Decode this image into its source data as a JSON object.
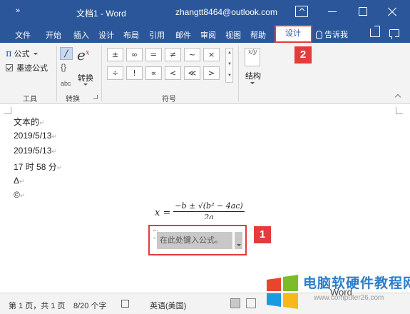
{
  "title_bar": {
    "quick_access": "»",
    "doc_title": "文档1 - Word",
    "account": "zhangtt8464@outlook.com"
  },
  "tabs": {
    "items": [
      "文件",
      "开始",
      "插入",
      "设计",
      "布局",
      "引用",
      "邮件",
      "审阅",
      "视图",
      "帮助"
    ],
    "active_contextual": "设计",
    "tell_me": "告诉我"
  },
  "ribbon": {
    "tools": {
      "equation": "公式",
      "ink_equation": "墨迹公式",
      "group_label": "工具"
    },
    "conversions": {
      "label": "转换",
      "group_label": "转换",
      "abc": "abc",
      "linear_glyph": "/",
      "braces_glyph": "{}",
      "big_glyph": "e",
      "big_sup": "x"
    },
    "symbols": {
      "row1": [
        "±",
        "∞",
        "=",
        "≠",
        "~",
        "×"
      ],
      "row2": [
        "÷",
        "!",
        "∝",
        "<",
        "≪",
        ">"
      ],
      "group_label": "符号"
    },
    "structures": {
      "label": "结构",
      "icon_text": "x/y"
    }
  },
  "document": {
    "lines": [
      "文本的",
      "2019/5/13",
      "2019/5/13",
      "17 时 58 分",
      "Δ",
      "©"
    ],
    "paragraph_mark": "↵",
    "formula": {
      "lhs": "x =",
      "numerator": "−b ± √(b² − 4ac)",
      "denominator": "2a"
    },
    "equation_placeholder": "在此处键入公式。"
  },
  "callouts": {
    "step1": "1",
    "step2": "2",
    "color": "#e53b3b"
  },
  "status_bar": {
    "page": "第 1 页，共 1 页",
    "words": "8/20 个字",
    "language": "英语(美国)"
  },
  "watermark": {
    "text": "电脑软硬件教程网",
    "url": "www.computer26.com",
    "word": "Word"
  },
  "theme": {
    "word_blue": "#2b579a",
    "ribbon_bg": "#f3f3f3"
  }
}
